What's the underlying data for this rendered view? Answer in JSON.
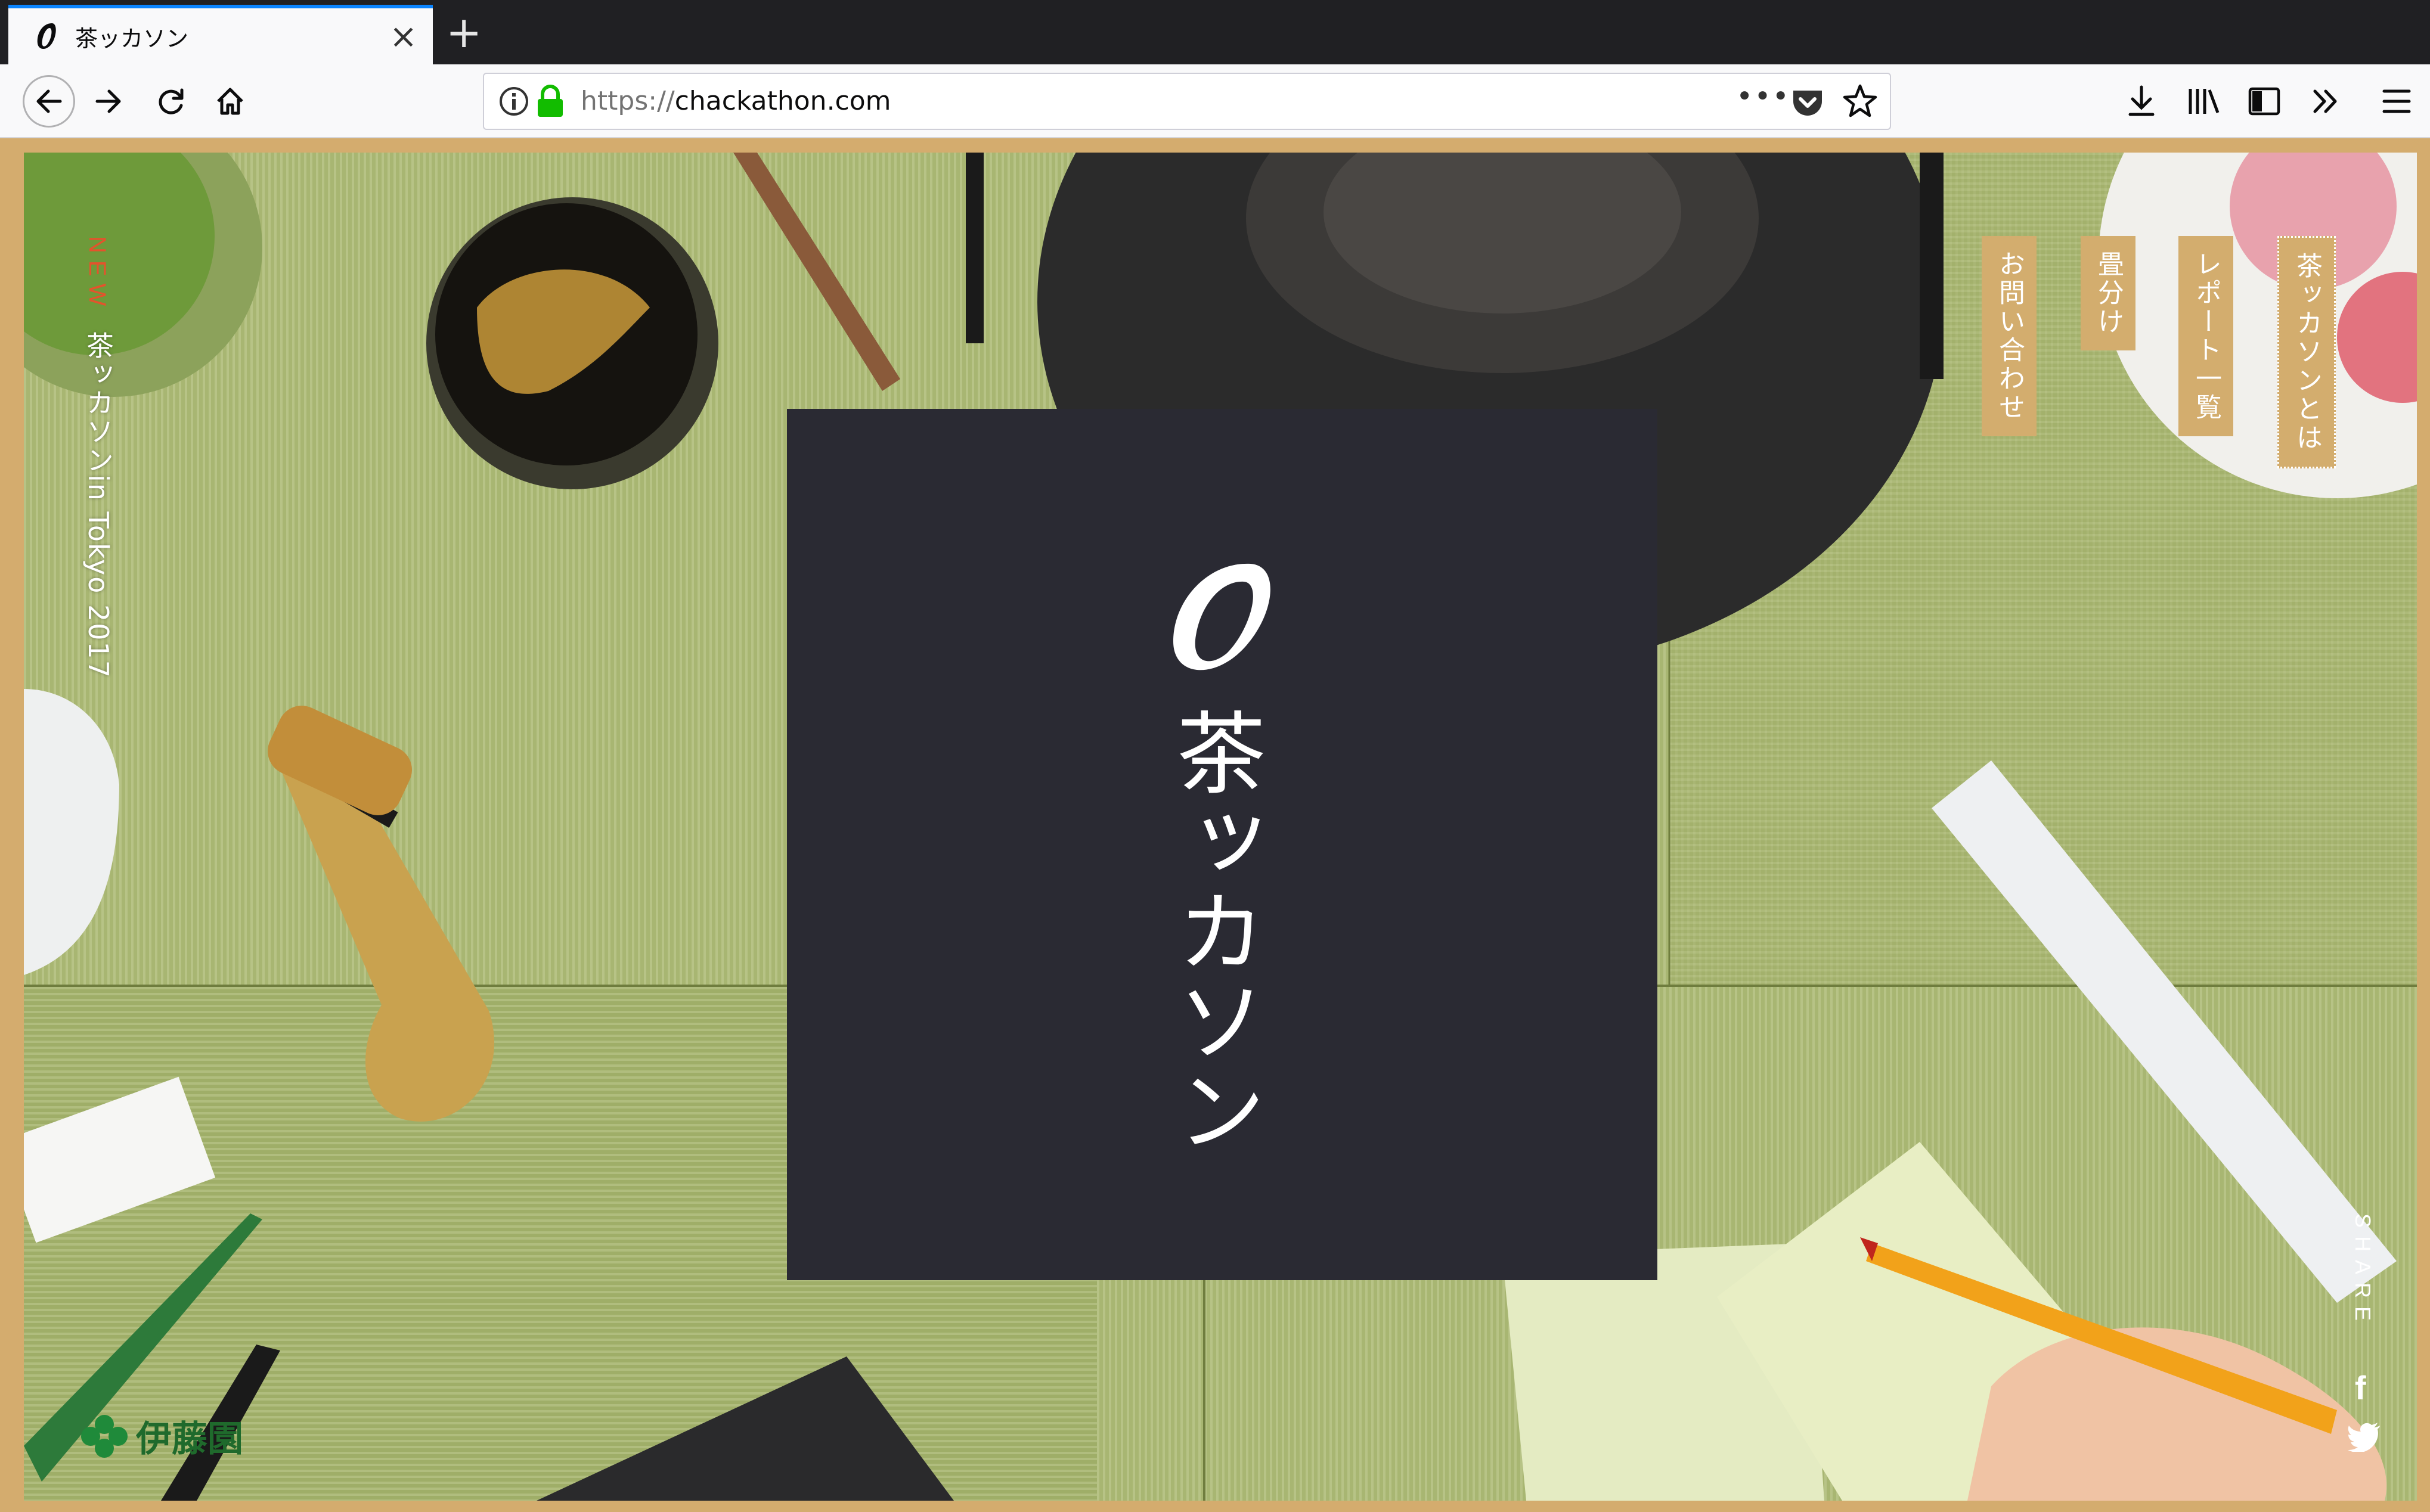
{
  "tab": {
    "title": "茶ッカソン",
    "close": "×",
    "new_tab": "+"
  },
  "toolbar": {
    "url_scheme": "https://",
    "url_host": "chackathon.com",
    "page_actions": "•••"
  },
  "site": {
    "new_label": "NEW",
    "event_title": "茶ッカソンin Tokyo 2017",
    "nav": {
      "about": "茶ッカソンとは",
      "reports": "レポート一覧",
      "mat": "畳分け",
      "contact": "お問い合わせ"
    },
    "logo_text": "茶ッカソン",
    "share_label": "SHARE",
    "facebook": "f",
    "sponsor": "伊藤園"
  },
  "colors": {
    "accent": "#d3ad6e",
    "logo_box": "#2a2a33",
    "new_label": "#e4532c",
    "tatami": "#a9b874"
  }
}
